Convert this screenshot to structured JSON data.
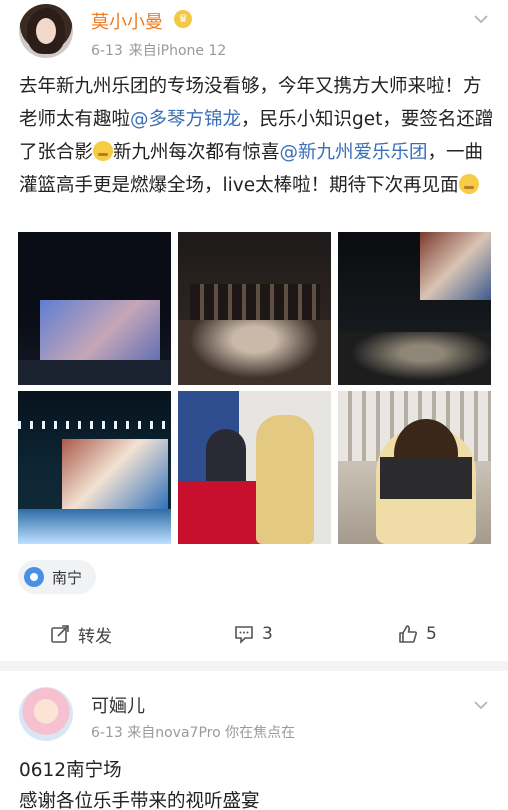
{
  "post": {
    "username": "莫小小曼",
    "date": "6-13",
    "source": "来自iPhone 12",
    "text_parts": [
      "去年新九州乐团的专场没看够，今年又携方大师来啦！方老师太有趣啦",
      "@多琴方锦龙",
      "，民乐小知识get，要签名还蹭了张合影",
      "新九州每次都有惊喜",
      "@新九州爱乐乐团",
      "，一曲灌篮高手更是燃爆全场，live太棒啦！期待下次再见面"
    ],
    "location": "南宁",
    "actions": {
      "share": "转发",
      "comments": "3",
      "likes": "5"
    }
  },
  "post2": {
    "username": "可婳儿",
    "date": "6-13",
    "source": "来自nova7Pro 你在焦点在",
    "line1": "0612南宁场",
    "line2": "感谢各位乐手带来的视听盛宴"
  },
  "colors": {
    "username": "#f07c22",
    "mention": "#3a6fb8",
    "meta": "#9a9a9a"
  }
}
